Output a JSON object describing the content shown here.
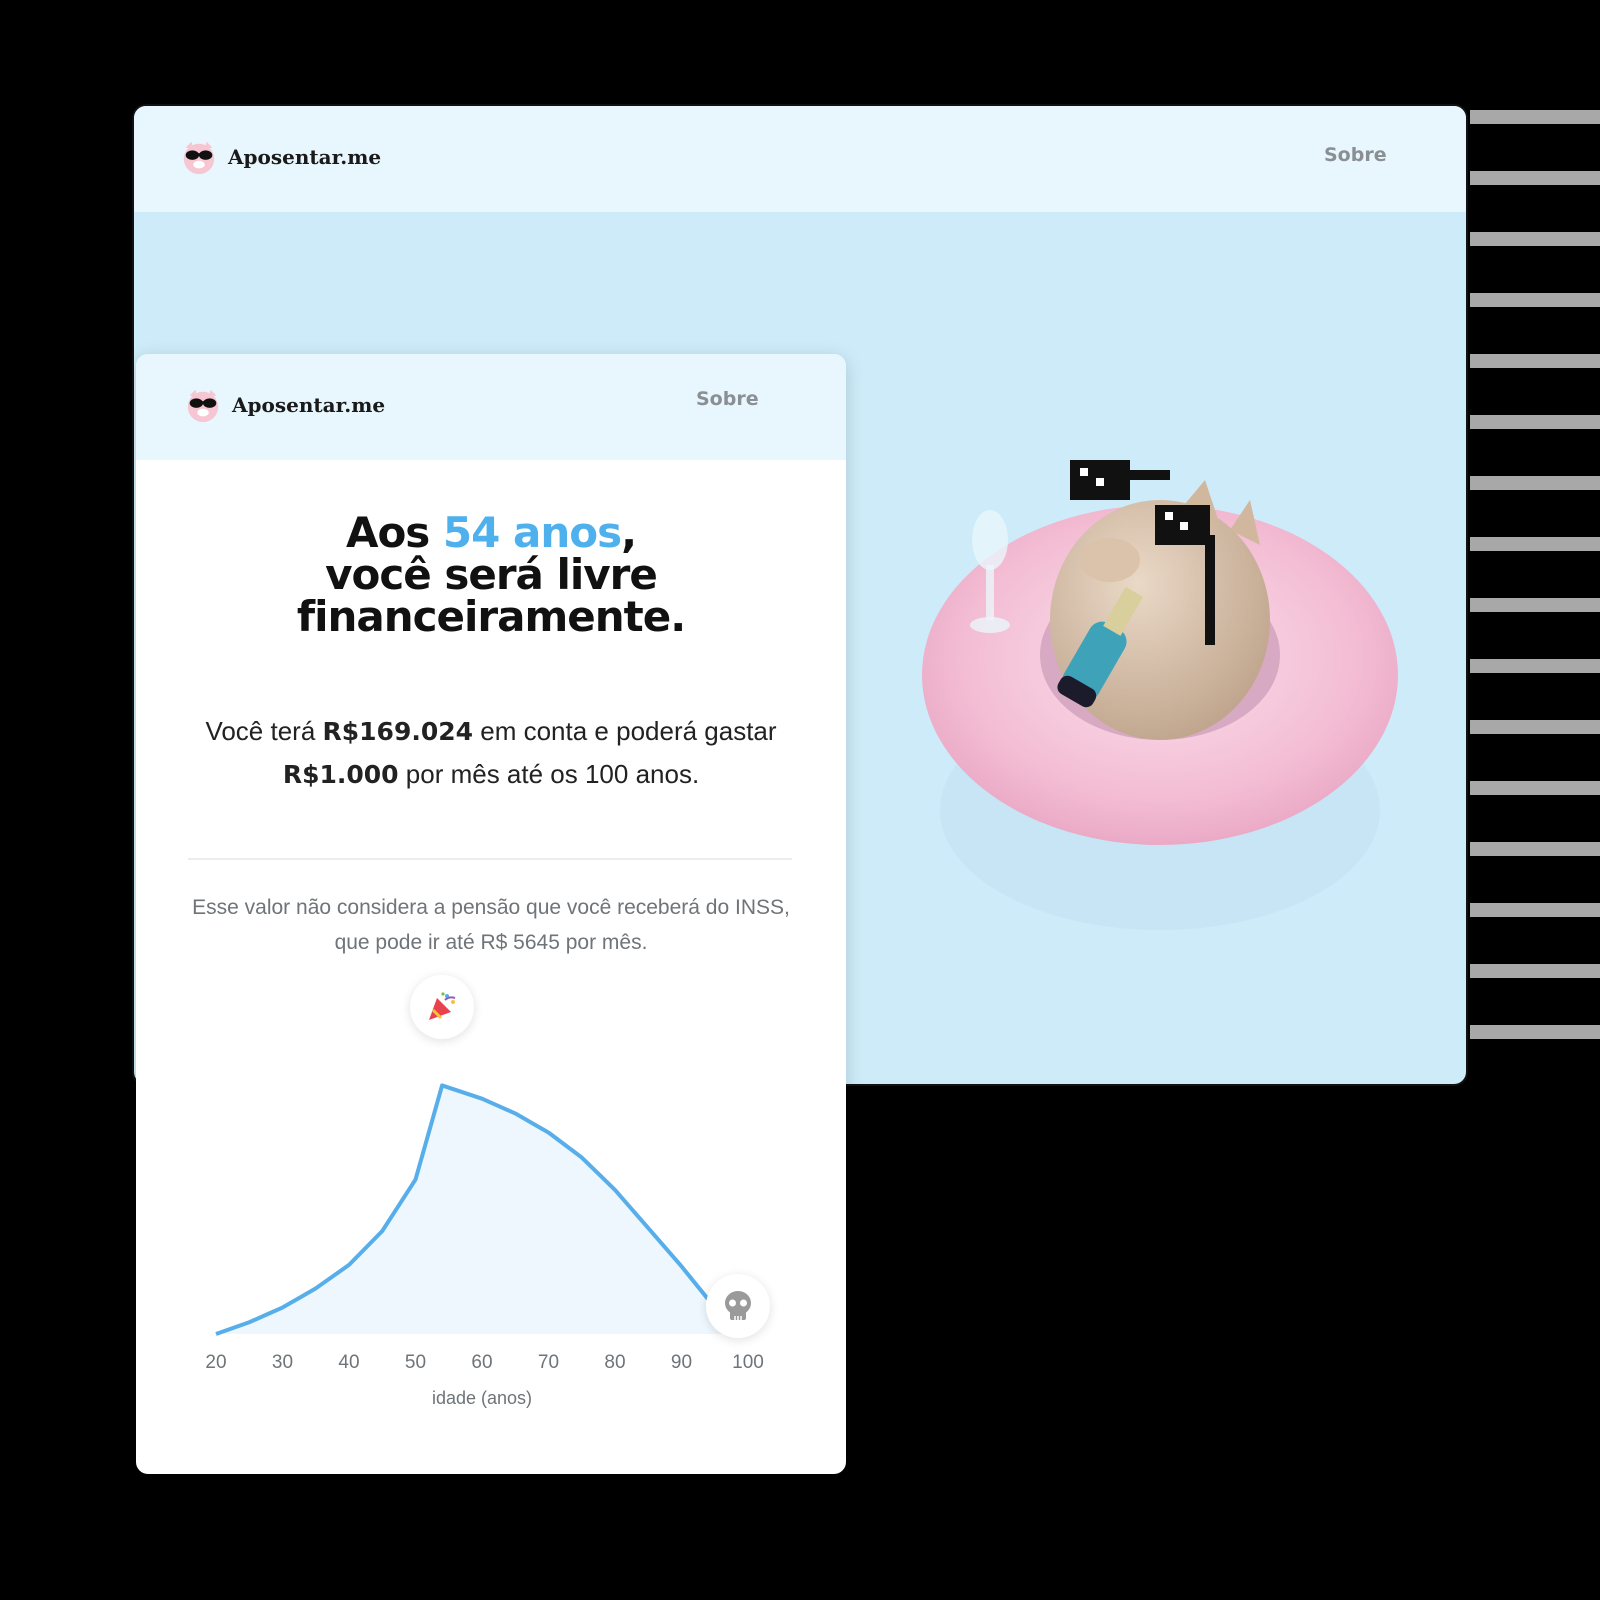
{
  "desktop": {
    "brand": "Aposentar.me",
    "nav_link": "Sobre"
  },
  "mobile": {
    "brand": "Aposentar.me",
    "nav_link": "Sobre",
    "headline": {
      "prefix": "Aos ",
      "age_highlight": "54 anos",
      "suffix": ",",
      "line2": "você será livre",
      "line3": "financeiramente."
    },
    "summary": {
      "part1": "Você terá ",
      "amount": "R$169.024",
      "part2": " em conta e poderá gastar ",
      "monthly": "R$1.000",
      "part3": " por mês até os 100 anos."
    },
    "note": "Esse valor não considera a pensão que você receberá do INSS, que pode ir até R$ 5645 por mês."
  },
  "colors": {
    "accent": "#4fb0ee",
    "line": "#57aeea",
    "area": "#eef7fd",
    "desktop_bg": "#cdebf8",
    "header_bg": "#e8f6fd"
  },
  "icons": {
    "retirement_marker": "party-popper-icon",
    "end_marker": "skull-icon",
    "logo": "pig-with-sunglasses-logo"
  },
  "chart_data": {
    "type": "area",
    "x": [
      20,
      25,
      30,
      35,
      40,
      45,
      50,
      54,
      60,
      65,
      70,
      75,
      80,
      85,
      90,
      95,
      100
    ],
    "values": [
      0,
      8000,
      18000,
      31000,
      47000,
      70000,
      105000,
      169024,
      160000,
      150000,
      137000,
      120000,
      98000,
      72000,
      46000,
      18000,
      0
    ],
    "xlabel": "idade (anos)",
    "xticks": [
      "20",
      "30",
      "40",
      "50",
      "60",
      "70",
      "80",
      "90",
      "100"
    ],
    "xlim": [
      20,
      100
    ],
    "ylim": [
      0,
      170000
    ],
    "peak_x": 54,
    "grid": false
  }
}
